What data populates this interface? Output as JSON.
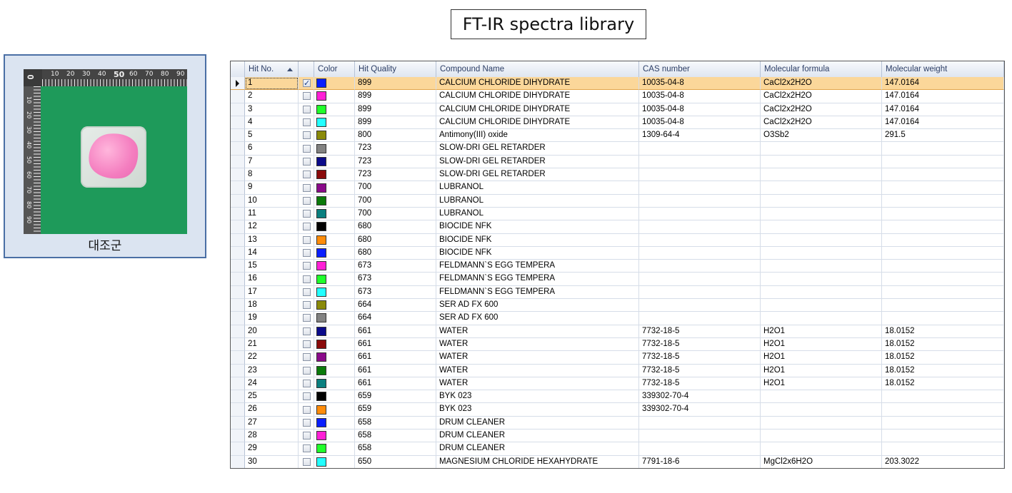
{
  "title": "FT-IR spectra library",
  "sample": {
    "caption": "대조군",
    "ruler_labels": [
      "10",
      "20",
      "30",
      "40",
      "50",
      "60",
      "70",
      "80",
      "90"
    ],
    "ruler_left_labels": [
      "10",
      "20",
      "30",
      "40",
      "50",
      "60",
      "70",
      "80",
      "90"
    ]
  },
  "columns": {
    "hit_no": "Hit No.",
    "check": "",
    "color": "Color",
    "quality": "Hit Quality",
    "name": "Compound Name",
    "cas": "CAS number",
    "formula": "Molecular formula",
    "weight": "Molecular weight"
  },
  "rows": [
    {
      "hit": "1",
      "checked": true,
      "color": "#0a1fff",
      "quality": "899",
      "name": "CALCIUM CHLORIDE DIHYDRATE",
      "cas": "10035-04-8",
      "formula": "CaCl2x2H2O",
      "weight": "147.0164"
    },
    {
      "hit": "2",
      "checked": false,
      "color": "#ff1fd6",
      "quality": "899",
      "name": "CALCIUM CHLORIDE DIHYDRATE",
      "cas": "10035-04-8",
      "formula": "CaCl2x2H2O",
      "weight": "147.0164"
    },
    {
      "hit": "3",
      "checked": false,
      "color": "#1fff2a",
      "quality": "899",
      "name": "CALCIUM CHLORIDE DIHYDRATE",
      "cas": "10035-04-8",
      "formula": "CaCl2x2H2O",
      "weight": "147.0164"
    },
    {
      "hit": "4",
      "checked": false,
      "color": "#22ffff",
      "quality": "899",
      "name": "CALCIUM CHLORIDE DIHYDRATE",
      "cas": "10035-04-8",
      "formula": "CaCl2x2H2O",
      "weight": "147.0164"
    },
    {
      "hit": "5",
      "checked": false,
      "color": "#8a8a0a",
      "quality": "800",
      "name": "Antimony(III) oxide",
      "cas": "1309-64-4",
      "formula": "O3Sb2",
      "weight": "291.5"
    },
    {
      "hit": "6",
      "checked": false,
      "color": "#828282",
      "quality": "723",
      "name": "SLOW-DRI GEL RETARDER",
      "cas": "",
      "formula": "",
      "weight": ""
    },
    {
      "hit": "7",
      "checked": false,
      "color": "#0a0a8a",
      "quality": "723",
      "name": "SLOW-DRI GEL RETARDER",
      "cas": "",
      "formula": "",
      "weight": ""
    },
    {
      "hit": "8",
      "checked": false,
      "color": "#8a0a0a",
      "quality": "723",
      "name": "SLOW-DRI GEL RETARDER",
      "cas": "",
      "formula": "",
      "weight": ""
    },
    {
      "hit": "9",
      "checked": false,
      "color": "#8a0a8a",
      "quality": "700",
      "name": "LUBRANOL",
      "cas": "",
      "formula": "",
      "weight": ""
    },
    {
      "hit": "10",
      "checked": false,
      "color": "#0a7a0a",
      "quality": "700",
      "name": "LUBRANOL",
      "cas": "",
      "formula": "",
      "weight": ""
    },
    {
      "hit": "11",
      "checked": false,
      "color": "#0a7f7f",
      "quality": "700",
      "name": "LUBRANOL",
      "cas": "",
      "formula": "",
      "weight": ""
    },
    {
      "hit": "12",
      "checked": false,
      "color": "#000000",
      "quality": "680",
      "name": "BIOCIDE NFK",
      "cas": "",
      "formula": "",
      "weight": ""
    },
    {
      "hit": "13",
      "checked": false,
      "color": "#ff8c0a",
      "quality": "680",
      "name": "BIOCIDE NFK",
      "cas": "",
      "formula": "",
      "weight": ""
    },
    {
      "hit": "14",
      "checked": false,
      "color": "#0a1fff",
      "quality": "680",
      "name": "BIOCIDE NFK",
      "cas": "",
      "formula": "",
      "weight": ""
    },
    {
      "hit": "15",
      "checked": false,
      "color": "#ff1fd6",
      "quality": "673",
      "name": "FELDMANN`S EGG TEMPERA",
      "cas": "",
      "formula": "",
      "weight": ""
    },
    {
      "hit": "16",
      "checked": false,
      "color": "#1fff2a",
      "quality": "673",
      "name": "FELDMANN`S EGG TEMPERA",
      "cas": "",
      "formula": "",
      "weight": ""
    },
    {
      "hit": "17",
      "checked": false,
      "color": "#22ffff",
      "quality": "673",
      "name": "FELDMANN`S EGG TEMPERA",
      "cas": "",
      "formula": "",
      "weight": ""
    },
    {
      "hit": "18",
      "checked": false,
      "color": "#8a8a0a",
      "quality": "664",
      "name": "SER AD FX 600",
      "cas": "",
      "formula": "",
      "weight": ""
    },
    {
      "hit": "19",
      "checked": false,
      "color": "#828282",
      "quality": "664",
      "name": "SER AD FX 600",
      "cas": "",
      "formula": "",
      "weight": ""
    },
    {
      "hit": "20",
      "checked": false,
      "color": "#0a0a8a",
      "quality": "661",
      "name": "WATER",
      "cas": "7732-18-5",
      "formula": "H2O1",
      "weight": "18.0152"
    },
    {
      "hit": "21",
      "checked": false,
      "color": "#8a0a0a",
      "quality": "661",
      "name": "WATER",
      "cas": "7732-18-5",
      "formula": "H2O1",
      "weight": "18.0152"
    },
    {
      "hit": "22",
      "checked": false,
      "color": "#8a0a8a",
      "quality": "661",
      "name": "WATER",
      "cas": "7732-18-5",
      "formula": "H2O1",
      "weight": "18.0152"
    },
    {
      "hit": "23",
      "checked": false,
      "color": "#0a7a0a",
      "quality": "661",
      "name": "WATER",
      "cas": "7732-18-5",
      "formula": "H2O1",
      "weight": "18.0152"
    },
    {
      "hit": "24",
      "checked": false,
      "color": "#0a7f7f",
      "quality": "661",
      "name": "WATER",
      "cas": "7732-18-5",
      "formula": "H2O1",
      "weight": "18.0152"
    },
    {
      "hit": "25",
      "checked": false,
      "color": "#000000",
      "quality": "659",
      "name": "BYK 023",
      "cas": "339302-70-4",
      "formula": "",
      "weight": ""
    },
    {
      "hit": "26",
      "checked": false,
      "color": "#ff8c0a",
      "quality": "659",
      "name": "BYK 023",
      "cas": "339302-70-4",
      "formula": "",
      "weight": ""
    },
    {
      "hit": "27",
      "checked": false,
      "color": "#0a1fff",
      "quality": "658",
      "name": "DRUM CLEANER",
      "cas": "",
      "formula": "",
      "weight": ""
    },
    {
      "hit": "28",
      "checked": false,
      "color": "#ff1fd6",
      "quality": "658",
      "name": "DRUM CLEANER",
      "cas": "",
      "formula": "",
      "weight": ""
    },
    {
      "hit": "29",
      "checked": false,
      "color": "#1fff2a",
      "quality": "658",
      "name": "DRUM CLEANER",
      "cas": "",
      "formula": "",
      "weight": ""
    },
    {
      "hit": "30",
      "checked": false,
      "color": "#22ffff",
      "quality": "650",
      "name": "MAGNESIUM CHLORIDE HEXAHYDRATE",
      "cas": "7791-18-6",
      "formula": "MgCl2x6H2O",
      "weight": "203.3022"
    }
  ],
  "selected_row": "1",
  "sort": {
    "column": "hit_no",
    "direction": "ascending",
    "icon": "sort-ascending-icon"
  }
}
